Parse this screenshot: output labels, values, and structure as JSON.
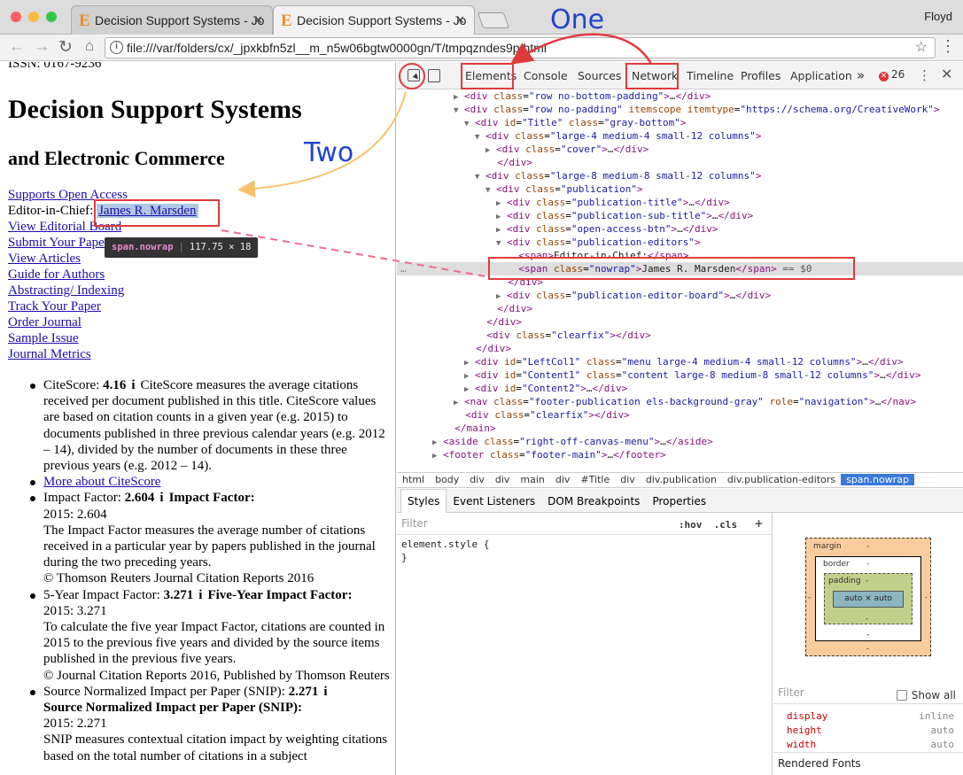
{
  "browser": {
    "tabs": [
      {
        "title": "Decision Support Systems - Jo",
        "favicon": "E"
      },
      {
        "title": "Decision Support Systems - Jo",
        "favicon": "E"
      }
    ],
    "user": "Floyd",
    "url": "file:///var/folders/cx/_jpxkbfn5zl__m_n5w06bgtw0000gn/T/tmpqznd",
    "url_tail": "es9p.html"
  },
  "page": {
    "issn": "ISSN: 0167-9236",
    "title": "Decision Support Systems",
    "subtitle": "and Electronic Commerce",
    "links": {
      "open_access": "Supports Open Access",
      "editor_label": "Editor-in-Chief:",
      "editor_name": "James R. Marsden",
      "items": [
        "View Editorial Board",
        "Submit Your Paper",
        "View Articles",
        "Guide for Authors",
        "Abstracting/ Indexing",
        "Track Your Paper",
        "Order Journal",
        "Sample Issue",
        "Journal Metrics"
      ]
    },
    "metrics": {
      "citescore_label": "CiteScore:",
      "citescore_value": "4.16",
      "citescore_desc": "CiteScore measures the average citations received per document published in this title. CiteScore values are based on citation counts in a given year (e.g. 2015) to documents published in three previous calendar years (e.g. 2012 – 14), divided by the number of documents in these three previous years (e.g. 2012 – 14).",
      "citescore_more": "More about CiteScore",
      "if_label": "Impact Factor:",
      "if_value": "2.604",
      "if_title": "Impact Factor:",
      "if_year": "2015: 2.604",
      "if_desc": "The Impact Factor measures the average number of citations received in a particular year by papers published in the journal during the two preceding years.",
      "if_copy": "© Thomson Reuters Journal Citation Reports 2016",
      "fy_label": "5-Year Impact Factor:",
      "fy_value": "3.271",
      "fy_title": "Five-Year Impact Factor:",
      "fy_year": "2015: 3.271",
      "fy_desc": "To calculate the five year Impact Factor, citations are counted in 2015 to the previous five years and divided by the source items published in the previous five years.",
      "fy_copy": "© Journal Citation Reports 2016, Published by Thomson Reuters",
      "snip_label": "Source Normalized Impact per Paper (SNIP):",
      "snip_value": "2.271",
      "snip_title": "Source Normalized Impact per Paper (SNIP):",
      "snip_year": "2015: 2.271",
      "snip_desc": "SNIP measures contextual citation impact by weighting citations based on the total number of citations in a subject"
    },
    "tooltip": {
      "selector": "span.nowrap",
      "size": "117.75 × 18"
    }
  },
  "devtools": {
    "tabs": [
      "Elements",
      "Console",
      "Sources",
      "Network",
      "Timeline",
      "Profiles",
      "Application"
    ],
    "overflow": "»",
    "error_count": "26",
    "selected_suffix": "== $0",
    "tree": [
      {
        "indent": 0,
        "arrow": "▶",
        "html": "<div class=\"row no-bottom-padding\">…</div>"
      },
      {
        "indent": 0,
        "arrow": "▼",
        "html": "<div class=\"row no-padding\" itemscope itemtype=\"https://schema.org/CreativeWork\">"
      },
      {
        "indent": 1,
        "arrow": "▼",
        "html": "<div id=\"Title\" class=\"gray-bottom\">"
      },
      {
        "indent": 2,
        "arrow": "▼",
        "html": "<div class=\"large-4 medium-4 small-12 columns\">"
      },
      {
        "indent": 3,
        "arrow": "▶",
        "html": "<div class=\"cover\">…</div>"
      },
      {
        "indent": 3,
        "arrow": "",
        "html": "</div>"
      },
      {
        "indent": 2,
        "arrow": "▼",
        "html": "<div class=\"large-8 medium-8 small-12 columns\">"
      },
      {
        "indent": 3,
        "arrow": "▼",
        "html": "<div class=\"publication\">"
      },
      {
        "indent": 4,
        "arrow": "▶",
        "html": "<div class=\"publication-title\">…</div>"
      },
      {
        "indent": 4,
        "arrow": "▶",
        "html": "<div class=\"publication-sub-title\">…</div>"
      },
      {
        "indent": 4,
        "arrow": "▶",
        "html": "<div class=\"open-access-btn\">…</div>"
      },
      {
        "indent": 4,
        "arrow": "▼",
        "html": "<div class=\"publication-editors\">"
      },
      {
        "indent": 5,
        "arrow": "",
        "html": "<span>Editor-in-Chief:</span>"
      },
      {
        "indent": 5,
        "arrow": "",
        "html": "<span class=\"nowrap\">James R. Marsden</span>",
        "selected": true
      },
      {
        "indent": 4,
        "arrow": "",
        "html": "</div>"
      },
      {
        "indent": 4,
        "arrow": "▶",
        "html": "<div class=\"publication-editor-board\">…</div>"
      },
      {
        "indent": 3,
        "arrow": "",
        "html": "</div>"
      },
      {
        "indent": 2,
        "arrow": "",
        "html": "</div>"
      },
      {
        "indent": 2,
        "arrow": "",
        "html": "<div class=\"clearfix\"></div>"
      },
      {
        "indent": 1,
        "arrow": "",
        "html": "</div>"
      },
      {
        "indent": 1,
        "arrow": "▶",
        "html": "<div id=\"LeftCol1\" class=\"menu large-4 medium-4 small-12 columns\">…</div>"
      },
      {
        "indent": 1,
        "arrow": "▶",
        "html": "<div id=\"Content1\" class=\"content large-8 medium-8 small-12 columns\">…</div>"
      },
      {
        "indent": 1,
        "arrow": "▶",
        "html": "<div id=\"Content2\">…</div>"
      },
      {
        "indent": 0,
        "arrow": "▶",
        "html": "<nav class=\"footer-publication els-background-gray\" role=\"navigation\">…</nav>"
      },
      {
        "indent": 0,
        "arrow": "",
        "html": "<div class=\"clearfix\"></div>"
      },
      {
        "indent": -1,
        "arrow": "",
        "html": "</main>"
      },
      {
        "indent": -2,
        "arrow": "▶",
        "html": "<aside class=\"right-off-canvas-menu\">…</aside>"
      },
      {
        "indent": -2,
        "arrow": "▶",
        "html": "<footer class=\"footer-main\">…</footer>"
      }
    ],
    "breadcrumbs": [
      "html",
      "body",
      "div",
      "div",
      "main",
      "div",
      "#Title",
      "div",
      "div.publication",
      "div.publication-editors",
      "span.nowrap"
    ],
    "styles_tabs": [
      "Styles",
      "Event Listeners",
      "DOM Breakpoints",
      "Properties"
    ],
    "filter_placeholder": "Filter",
    "hov": ":hov",
    "cls": ".cls",
    "plus": "+",
    "element_style": "element.style {",
    "element_style_close": "}",
    "box_model": {
      "margin": "margin",
      "border": "border",
      "padding": "padding",
      "content": "auto × auto",
      "dash": "-"
    },
    "computed": {
      "filter": "Filter",
      "show_all": "Show all",
      "props": [
        {
          "name": "display",
          "value": "inline"
        },
        {
          "name": "height",
          "value": "auto"
        },
        {
          "name": "width",
          "value": "auto"
        }
      ],
      "rendered_fonts": "Rendered Fonts"
    }
  },
  "annotations": {
    "one": "One",
    "two": "Two",
    "colors": {
      "box": "#e03b3b",
      "arrow_orange": "#f5c26b",
      "label_blue": "#2244cc"
    }
  }
}
